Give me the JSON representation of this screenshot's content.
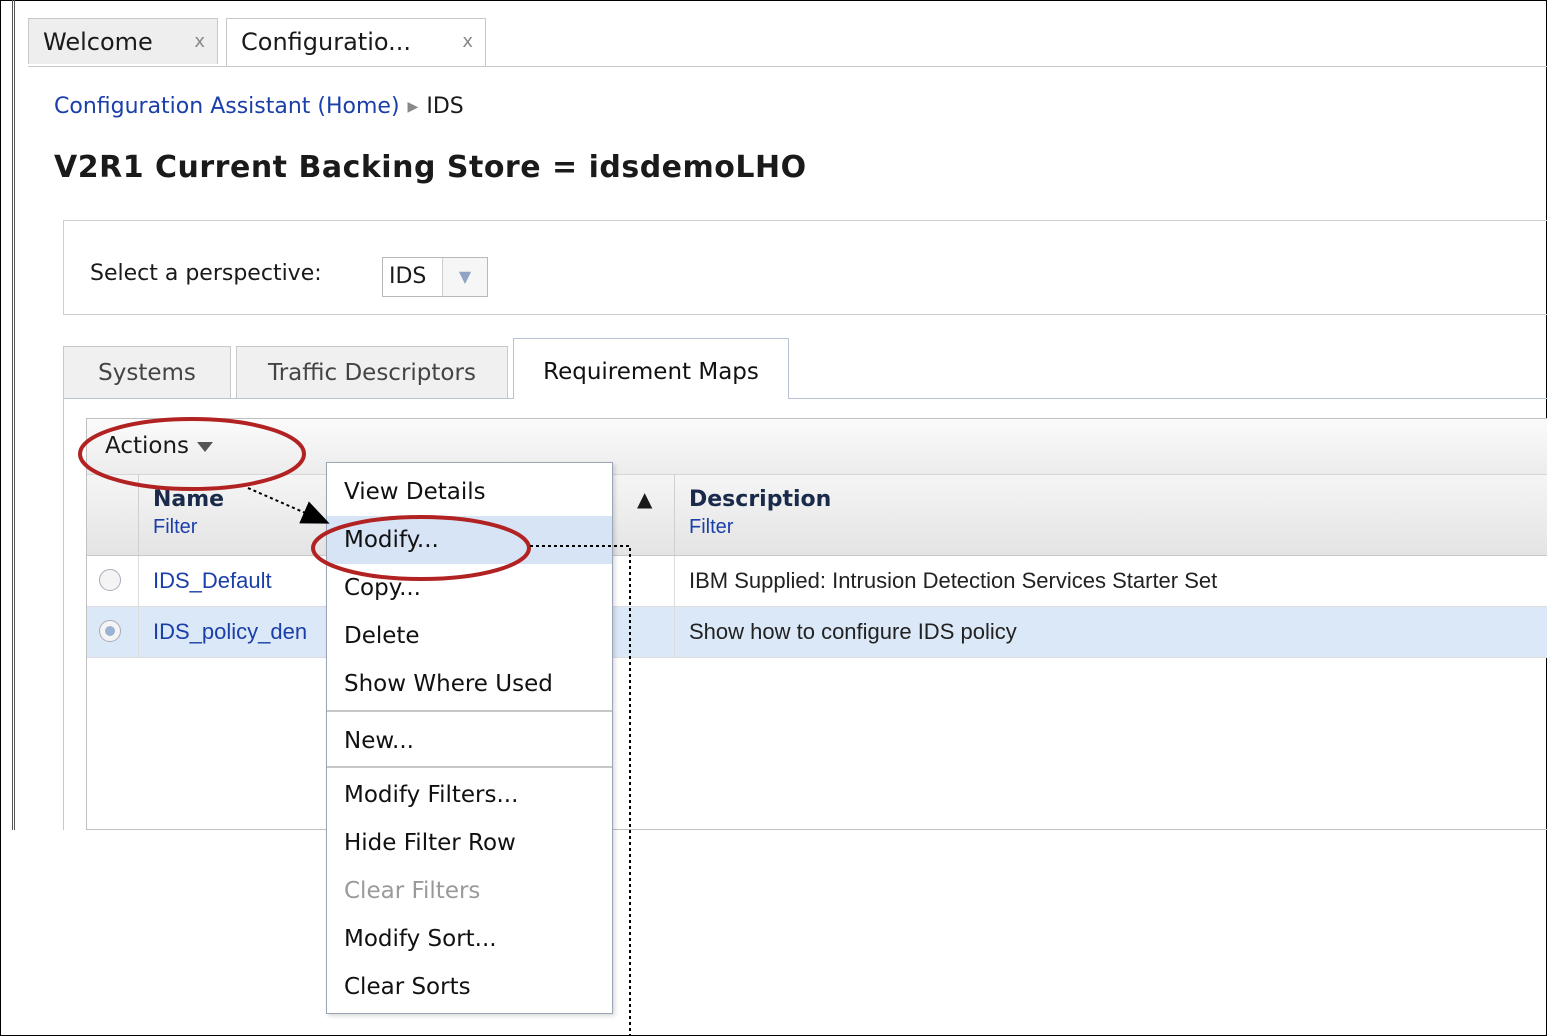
{
  "doc_tabs": [
    {
      "label": "Welcome",
      "close": "x"
    },
    {
      "label": "Configuratio...",
      "close": "x"
    }
  ],
  "breadcrumb": {
    "home": "Configuration Assistant (Home)",
    "current": "IDS"
  },
  "page_title": "V2R1 Current Backing Store = idsdemoLHO",
  "perspective": {
    "label": "Select a perspective:",
    "value": "IDS"
  },
  "panel_tabs": [
    "Systems",
    "Traffic Descriptors",
    "Requirement Maps"
  ],
  "actions_label": "Actions",
  "table": {
    "headers": {
      "name": "Name",
      "name_filter": "Filter",
      "description": "Description",
      "description_filter": "Filter",
      "sort_indicator": "▲"
    },
    "rows": [
      {
        "name": "IDS_Default",
        "description": "IBM Supplied: Intrusion Detection Services Starter Set",
        "selected": false
      },
      {
        "name": "IDS_policy_den",
        "description": "Show how to configure IDS policy",
        "selected": true
      }
    ]
  },
  "menu": {
    "items": [
      "View Details",
      "Modify...",
      "Copy...",
      "Delete",
      "Show Where Used",
      "New...",
      "Modify Filters...",
      "Hide Filter Row",
      "Clear Filters",
      "Modify Sort...",
      "Clear Sorts"
    ],
    "highlighted": "Modify...",
    "disabled": [
      "Clear Filters"
    ]
  },
  "colors": {
    "annotation_ring": "#b22222",
    "link": "#1a3fa8",
    "selected_row": "#dbe8f7"
  }
}
